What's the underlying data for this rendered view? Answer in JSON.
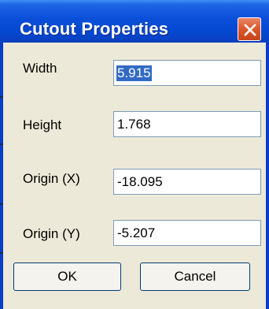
{
  "dialog": {
    "title": "Cutout Properties",
    "fields": {
      "width_label": "Width",
      "width_value": "5.915",
      "height_label": "Height",
      "height_value": "1.768",
      "origin_x_label": "Origin (X)",
      "origin_x_value": "-18.095",
      "origin_y_label": "Origin (Y)",
      "origin_y_value": "-5.207"
    },
    "buttons": {
      "ok": "OK",
      "cancel": "Cancel"
    },
    "icons": {
      "close": "close-icon"
    },
    "colors": {
      "titlebar": "#0A4FD8",
      "client_background": "#ECE9D8",
      "close_button": "#DD5A2E",
      "selection": "#316AC5"
    }
  }
}
